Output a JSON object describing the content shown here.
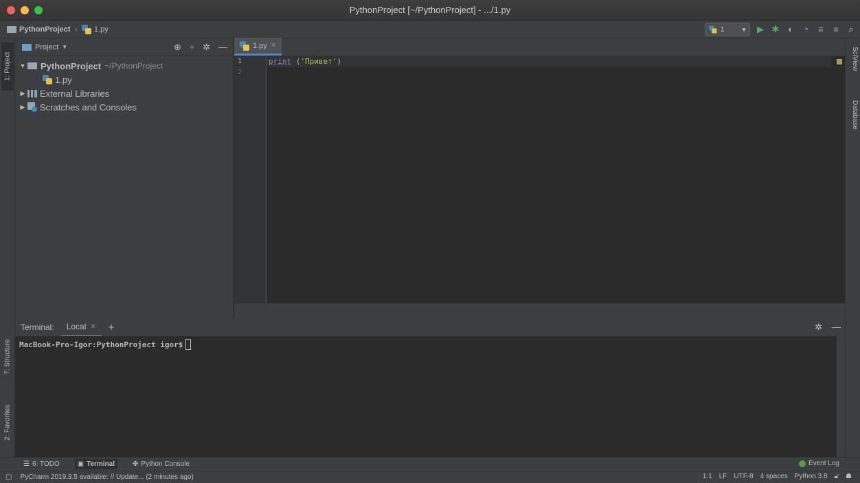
{
  "window": {
    "title": "PythonProject [~/PythonProject] - .../1.py"
  },
  "navbar": {
    "project": "PythonProject",
    "file": "1.py",
    "run_config": "1"
  },
  "left_stripe": {
    "project_tab": "1: Project",
    "structure_tab": "7: Structure",
    "favorites_tab": "2: Favorites"
  },
  "right_stripe": {
    "sciview_tab": "SciView",
    "database_tab": "Database"
  },
  "project_panel": {
    "title": "Project",
    "root": {
      "name": "PythonProject",
      "path": "~/PythonProject"
    },
    "file": "1.py",
    "external_libraries": "External Libraries",
    "scratches": "Scratches and Consoles"
  },
  "editor": {
    "tab": "1.py",
    "line_numbers": [
      "1",
      "2"
    ],
    "code": {
      "func": "print",
      "open": " (",
      "string": "'Привет'",
      "close": ")"
    }
  },
  "terminal": {
    "label": "Terminal:",
    "tab": "Local",
    "prompt": "MacBook-Pro-Igor:PythonProject igor$"
  },
  "bottom_tools": {
    "todo": "6: TODO",
    "terminal": "Terminal",
    "python_console": "Python Console",
    "event_log": "Event Log"
  },
  "status": {
    "message": "PyCharm 2019.3.5 available: // Update... (2 minutes ago)",
    "position": "1:1",
    "line_sep": "LF",
    "encoding": "UTF-8",
    "indent": "4 spaces",
    "interpreter": "Python 3.8"
  },
  "colors": {
    "accent": "#4a88c7",
    "close": "#fc605c",
    "minimize": "#fdbc40",
    "zoom": "#34c84a",
    "string": "#a5c25c",
    "builtin": "#8888c6"
  }
}
